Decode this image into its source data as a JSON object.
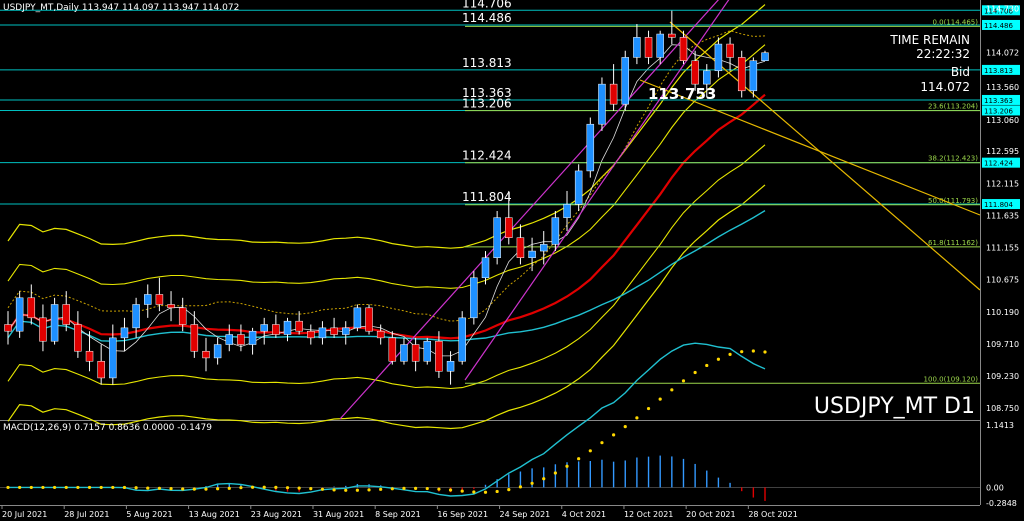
{
  "header": {
    "symbol_line": "USDJPY_MT,Daily  113.947 114.097 113.947 114.072",
    "macd_label": "MACD(12,26,9) 0.7157 0.8636 0.0000 -0.1479"
  },
  "info_panel": {
    "time_remain_label": "TIME REMAIN",
    "time_remain_value": "22:22:32",
    "bid_label": "Bid",
    "bid_value": "114.072",
    "last_marker": "113.753"
  },
  "watermark": "USDJPY_MT D1",
  "levels": [
    {
      "label": "114.706",
      "tag": "114.706",
      "y": 114.706
    },
    {
      "label": "114.486",
      "tag": "114.486",
      "y": 114.486
    },
    {
      "label": "113.813",
      "tag": "113.813",
      "y": 113.813
    },
    {
      "label": "113.363",
      "tag": "113.363",
      "y": 113.363
    },
    {
      "label": "113.206",
      "tag": "113.206",
      "y": 113.206
    },
    {
      "label": "112.424",
      "tag": "112.424",
      "y": 112.424
    },
    {
      "label": "111.804",
      "tag": "111.804",
      "y": 111.804
    }
  ],
  "fib_levels": [
    {
      "label": "0.0(114.465)",
      "y": 114.465
    },
    {
      "label": "23.6(113.204)",
      "y": 113.204
    },
    {
      "label": "38.2(112.423)",
      "y": 112.423
    },
    {
      "label": "50.0(111.793)",
      "y": 111.793
    },
    {
      "label": "61.8(111.162)",
      "y": 111.162
    },
    {
      "label": "100.0(109.120)",
      "y": 109.12
    }
  ],
  "price_axis": [
    "114.730",
    "114.072",
    "113.560",
    "113.060",
    "112.595",
    "112.115",
    "111.635",
    "111.155",
    "110.675",
    "110.190",
    "109.710",
    "109.230",
    "108.750"
  ],
  "macd_axis": [
    "1.1413",
    "0.00",
    "-0.2848"
  ],
  "dates": [
    "20 Jul 2021",
    "28 Jul 2021",
    "5 Aug 2021",
    "13 Aug 2021",
    "23 Aug 2021",
    "31 Aug 2021",
    "8 Sep 2021",
    "16 Sep 2021",
    "24 Sep 2021",
    "4 Oct 2021",
    "12 Oct 2021",
    "20 Oct 2021",
    "28 Oct 2021"
  ],
  "colors": {
    "bull": "#1e90ff",
    "bear": "#e00000",
    "level": "#00bfbf",
    "tag_bg": "#00ffff",
    "fib": "#9bd64a",
    "channel": "#cc33cc",
    "trend": "#e6b800"
  },
  "chart_data": {
    "type": "candlestick",
    "symbol": "USDJPY_MT",
    "timeframe": "Daily",
    "ylim": [
      108.6,
      114.8
    ],
    "candles": [
      [
        110.0,
        110.2,
        109.7,
        109.9
      ],
      [
        109.9,
        110.5,
        109.8,
        110.4
      ],
      [
        110.4,
        110.6,
        110.0,
        110.1
      ],
      [
        110.1,
        110.3,
        109.6,
        109.75
      ],
      [
        109.75,
        110.4,
        109.7,
        110.3
      ],
      [
        110.3,
        110.5,
        109.9,
        110.0
      ],
      [
        110.0,
        110.2,
        109.5,
        109.6
      ],
      [
        109.6,
        109.9,
        109.3,
        109.45
      ],
      [
        109.45,
        109.7,
        109.1,
        109.2
      ],
      [
        109.2,
        110.0,
        109.1,
        109.8
      ],
      [
        109.8,
        110.1,
        109.6,
        109.95
      ],
      [
        109.95,
        110.4,
        109.8,
        110.3
      ],
      [
        110.3,
        110.6,
        110.1,
        110.45
      ],
      [
        110.45,
        110.7,
        110.2,
        110.3
      ],
      [
        110.3,
        110.5,
        110.05,
        110.25
      ],
      [
        110.25,
        110.4,
        109.9,
        110.0
      ],
      [
        110.0,
        110.2,
        109.5,
        109.6
      ],
      [
        109.6,
        109.8,
        109.3,
        109.5
      ],
      [
        109.5,
        109.8,
        109.4,
        109.7
      ],
      [
        109.7,
        110.0,
        109.6,
        109.85
      ],
      [
        109.85,
        110.0,
        109.6,
        109.7
      ],
      [
        109.7,
        109.95,
        109.55,
        109.9
      ],
      [
        109.9,
        110.1,
        109.7,
        110.0
      ],
      [
        110.0,
        110.15,
        109.8,
        109.85
      ],
      [
        109.85,
        110.1,
        109.75,
        110.05
      ],
      [
        110.05,
        110.2,
        109.85,
        109.9
      ],
      [
        109.9,
        110.0,
        109.7,
        109.8
      ],
      [
        109.8,
        110.05,
        109.7,
        109.95
      ],
      [
        109.95,
        110.1,
        109.8,
        109.85
      ],
      [
        109.85,
        110.05,
        109.7,
        109.95
      ],
      [
        109.95,
        110.3,
        109.9,
        110.25
      ],
      [
        110.25,
        110.3,
        109.85,
        109.9
      ],
      [
        109.9,
        110.0,
        109.7,
        109.8
      ],
      [
        109.8,
        109.9,
        109.4,
        109.45
      ],
      [
        109.45,
        109.8,
        109.4,
        109.7
      ],
      [
        109.7,
        109.8,
        109.3,
        109.45
      ],
      [
        109.45,
        109.8,
        109.4,
        109.75
      ],
      [
        109.75,
        109.9,
        109.2,
        109.3
      ],
      [
        109.3,
        109.6,
        109.1,
        109.45
      ],
      [
        109.45,
        110.2,
        109.4,
        110.1
      ],
      [
        110.1,
        110.8,
        110.0,
        110.7
      ],
      [
        110.7,
        111.1,
        110.6,
        111.0
      ],
      [
        111.0,
        111.7,
        110.9,
        111.6
      ],
      [
        111.6,
        112.0,
        111.2,
        111.3
      ],
      [
        111.3,
        111.5,
        110.9,
        111.0
      ],
      [
        111.0,
        111.3,
        110.8,
        111.1
      ],
      [
        111.1,
        111.4,
        110.9,
        111.2
      ],
      [
        111.2,
        111.7,
        111.1,
        111.6
      ],
      [
        111.6,
        112.0,
        111.4,
        111.8
      ],
      [
        111.8,
        112.4,
        111.7,
        112.3
      ],
      [
        112.3,
        113.1,
        112.2,
        113.0
      ],
      [
        113.0,
        113.7,
        112.9,
        113.6
      ],
      [
        113.6,
        113.9,
        113.2,
        113.3
      ],
      [
        113.3,
        114.1,
        113.2,
        114.0
      ],
      [
        114.0,
        114.5,
        113.9,
        114.3
      ],
      [
        114.3,
        114.4,
        113.9,
        114.0
      ],
      [
        114.0,
        114.4,
        113.9,
        114.35
      ],
      [
        114.35,
        114.7,
        114.2,
        114.3
      ],
      [
        114.3,
        114.4,
        113.9,
        113.95
      ],
      [
        113.95,
        114.1,
        113.5,
        113.6
      ],
      [
        113.6,
        113.9,
        113.4,
        113.8
      ],
      [
        113.8,
        114.3,
        113.7,
        114.2
      ],
      [
        114.2,
        114.3,
        113.8,
        114.0
      ],
      [
        114.0,
        114.1,
        113.4,
        113.5
      ],
      [
        113.5,
        114.0,
        113.4,
        113.95
      ],
      [
        113.95,
        114.1,
        113.95,
        114.07
      ]
    ],
    "macd": {
      "name": "MACD(12,26,9)",
      "values": [
        0.7157,
        0.8636,
        0.0,
        -0.1479
      ],
      "ylim": [
        -0.2848,
        1.1413
      ]
    }
  }
}
